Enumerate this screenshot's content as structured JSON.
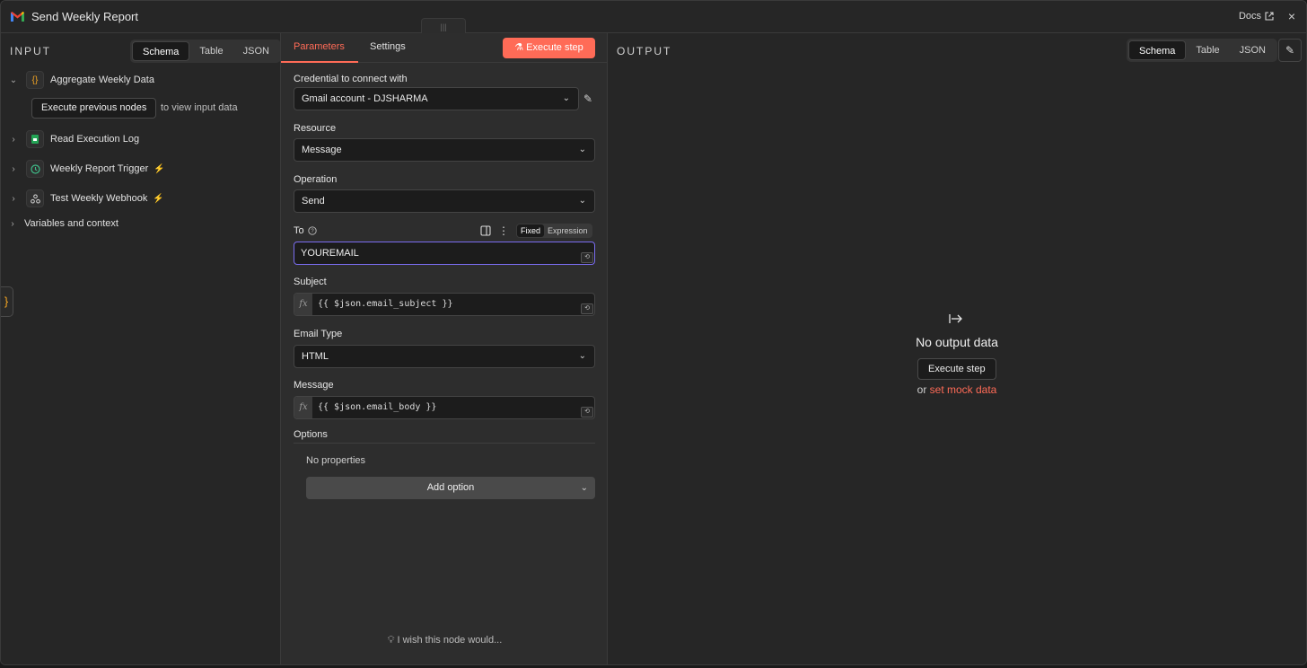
{
  "header": {
    "title": "Send Weekly Report",
    "docs_label": "Docs",
    "close_icon": "×"
  },
  "input_panel": {
    "title": "INPUT",
    "view_tabs": [
      "Schema",
      "Table",
      "JSON"
    ],
    "active_view": "Schema",
    "nodes": [
      {
        "label": "Aggregate Weekly Data",
        "icon": "braces-icon",
        "expanded": true,
        "trigger": false
      },
      {
        "label": "Read Execution Log",
        "icon": "spreadsheet-icon",
        "expanded": false,
        "trigger": false
      },
      {
        "label": "Weekly Report Trigger",
        "icon": "clock-icon",
        "expanded": false,
        "trigger": true
      },
      {
        "label": "Test Weekly Webhook",
        "icon": "webhook-icon",
        "expanded": false,
        "trigger": true
      }
    ],
    "execute_previous_label": "Execute previous nodes",
    "execute_previous_hint": "to view input data",
    "variables_label": "Variables and context"
  },
  "parameters": {
    "tabs": [
      "Parameters",
      "Settings"
    ],
    "active_tab": "Parameters",
    "execute_button": "Execute step",
    "credential": {
      "label": "Credential to connect with",
      "value": "Gmail account - DJSHARMA"
    },
    "resource": {
      "label": "Resource",
      "value": "Message"
    },
    "operation": {
      "label": "Operation",
      "value": "Send"
    },
    "to": {
      "label": "To",
      "value": "YOUREMAIL",
      "mode_options": [
        "Fixed",
        "Expression"
      ],
      "mode": "Fixed"
    },
    "subject": {
      "label": "Subject",
      "value": "{{ $json.email_subject }}"
    },
    "email_type": {
      "label": "Email Type",
      "value": "HTML"
    },
    "message": {
      "label": "Message",
      "value": "{{ $json.email_body }}"
    },
    "options": {
      "label": "Options",
      "empty_text": "No properties",
      "add_option_label": "Add option"
    },
    "feedback": "I wish this node would..."
  },
  "output_panel": {
    "title": "OUTPUT",
    "view_tabs": [
      "Schema",
      "Table",
      "JSON"
    ],
    "active_view": "Schema",
    "empty_title": "No output data",
    "execute_button": "Execute step",
    "mock_prefix": "or",
    "mock_link": "set mock data"
  },
  "colors": {
    "accent": "#ff6b57",
    "focus_border": "#7a6df0",
    "background": "#262626"
  }
}
